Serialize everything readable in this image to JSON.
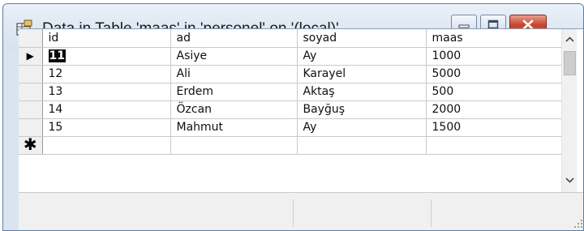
{
  "window": {
    "title": "Data in Table 'maas' in 'personel' on '(local)'",
    "icon": "table-icon",
    "controls": {
      "minimize": "minimize-icon",
      "maximize": "maximize-icon",
      "close": "close-icon"
    },
    "accent_colors": {
      "close": "#c7412a",
      "titlebar": "#d9e4f1"
    }
  },
  "grid": {
    "columns": [
      "id",
      "ad",
      "soyad",
      "maas"
    ],
    "rows": [
      {
        "id": "11",
        "ad": "Asiye",
        "soyad": "Ay",
        "maas": "1000"
      },
      {
        "id": "12",
        "ad": "Ali",
        "soyad": "Karayel",
        "maas": "5000"
      },
      {
        "id": "13",
        "ad": "Erdem",
        "soyad": "Aktaş",
        "maas": "500"
      },
      {
        "id": "14",
        "ad": "Özcan",
        "soyad": "Bayğuş",
        "maas": "2000"
      },
      {
        "id": "15",
        "ad": "Mahmut",
        "soyad": "Ay",
        "maas": "1500"
      }
    ],
    "current_row_marker": "▶",
    "new_row_marker": "✱"
  },
  "scrollbar": {
    "up_arrow": "⌃",
    "down_arrow": "⌄"
  }
}
